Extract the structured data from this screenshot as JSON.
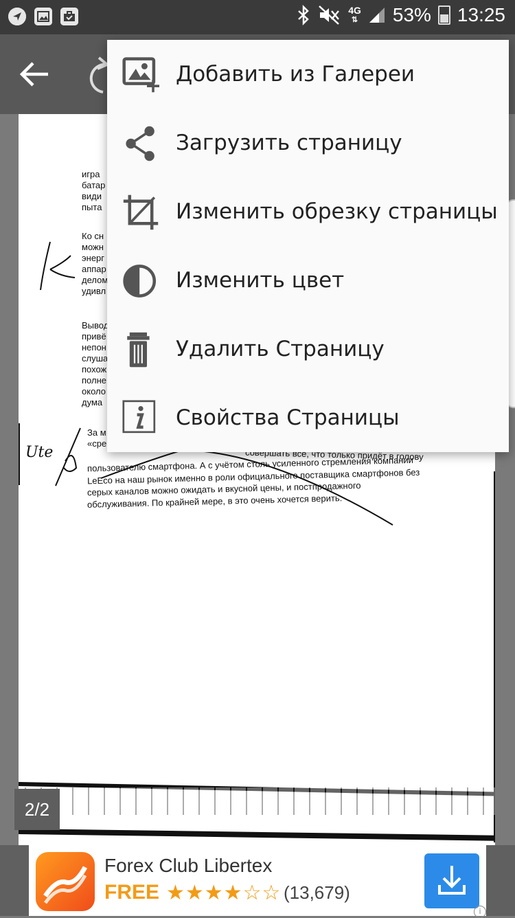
{
  "status": {
    "network": "4G",
    "battery": "53%",
    "time": "13:25"
  },
  "page_indicator": "2/2",
  "menu": {
    "items": [
      {
        "label": "Добавить из Галереи",
        "icon": "add-from-gallery-icon"
      },
      {
        "label": "Загрузить страницу",
        "icon": "share-icon"
      },
      {
        "label": "Изменить обрезку страницы",
        "icon": "crop-icon"
      },
      {
        "label": "Изменить цвет",
        "icon": "contrast-icon"
      },
      {
        "label": "Удалить Страницу",
        "icon": "trash-icon"
      },
      {
        "label": "Свойства Страницы",
        "icon": "info-icon"
      }
    ]
  },
  "document": {
    "left_fragments": [
      "игра",
      "батар",
      "види",
      "пыта",
      "Ко сн",
      "можн",
      "энерг",
      "аппар",
      "делом",
      "удивл",
      "Вывод",
      "привё",
      "непон",
      "слуша",
      "похож",
      "полне",
      "около",
      "дума"
    ],
    "para_lines": [
      "За м",
      "«сре",
      "пользователю смартфона. А с учётом столь усиленного стремления компании",
      "LeEco на наш рынок именно в роли официального поставщика смартфонов без",
      "серых каналов можно ожидать и вкусной цены, и постпродажного",
      "обслуживания. По крайней мере, в это очень хочется верить."
    ],
    "line2_tail": "совершать все, что только придёт в голову",
    "margin_note": "Ute"
  },
  "ad": {
    "title": "Forex Club Libertex",
    "price": "FREE",
    "stars": "★★★★☆☆",
    "rating": 3.5,
    "reviews": "(13,679)",
    "info_glyph": "i"
  }
}
